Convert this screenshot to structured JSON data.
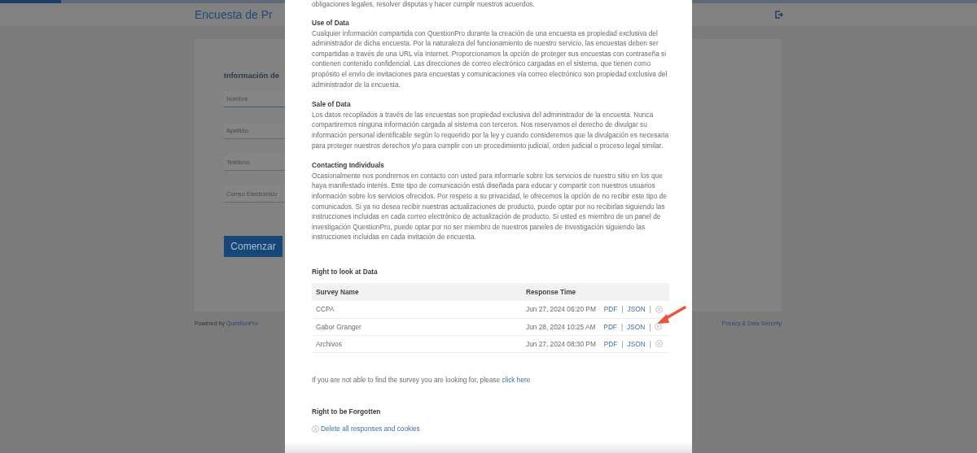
{
  "page": {
    "progress": {
      "level": 0.0625
    },
    "title": "Encuesta de Pr",
    "form_heading": "Información de",
    "fields": [
      {
        "placeholder": "Nombre",
        "focused": true
      },
      {
        "placeholder": "Apellido",
        "focused": false
      },
      {
        "placeholder": "Teléfono",
        "focused": false
      },
      {
        "placeholder": "Correo Electrónico",
        "focused": false
      }
    ],
    "start_button": "Comenzar",
    "footer_prefix": "Powered by",
    "footer_brand": "QuestionPro",
    "footer_right": "Privacy & Data Security"
  },
  "modal": {
    "intro_tail": "obligaciones legales, resolver disputas y hacer cumplir nuestros acuerdos.",
    "sections": [
      {
        "heading": "Use of Data",
        "text": "Cualquier información compartida con QuestionPro durante la creación de una encuesta es propiedad exclusiva del administrador de dicha encuesta. Por la naturaleza del funcionamiento de nuestro servicio, las encuestas deben ser compartidas a través de una URL vía Internet. Proporcionamos la opción de proteger sus encuestas con contraseña si contienen contenido confidencial. Las direcciones de correo electrónico cargadas en el sistema, que tienen como propósito el envío de invitaciones para encuestas y comunicaciones vía correo electrónico son propiedad exclusiva del administrador de la encuesta."
      },
      {
        "heading": "Sale of Data",
        "text": "Los datos recopilados a través de las encuestas son propiedad exclusiva del administrador de la encuesta. Nunca compartiremos ninguna información cargada al sistema con terceros. Nos reservamos el derecho de divulgar su información personal identificable según lo requerido por la ley y cuando consideremos que la divulgación es necesaria para proteger nuestros derechos y/o para cumplir con un procedimiento judicial, orden judicial o proceso legal similar."
      },
      {
        "heading": "Contacting Individuals",
        "text": "Ocasionalmente nos pondremos en contacto con usted para informarle sobre los servicios de nuestro sitio en los que haya manifestado interés. Este tipo de comunicación está diseñada para educar y compartir con nuestros usuarios información sobre los servicios ofrecidos. Por respeto a su privacidad, le ofrecemos la opción de no recibir este tipo de comunicados. Si ya no desea recibir nuestras actualizaciones de producto, puede optar por no recibirlas siguiendo las instrucciones incluidas en cada correo electrónico de actualización de producto. Si usted es miembro de un panel de investigación QuestionPro, puede optar por no ser miembro de nuestros paneles de investigación siguiendo las instrucciones incluidas en cada invitación de encuesta."
      }
    ],
    "data_heading": "Right to look at Data",
    "table": {
      "columns": [
        "Survey Name",
        "Response Time"
      ],
      "separator": "|",
      "rows": [
        {
          "survey": "CCPA",
          "time": "Jun 27, 2024 06:20 PM",
          "links": [
            "PDF",
            "JSON"
          ]
        },
        {
          "survey": "Gabor Granger",
          "time": "Jun 28, 2024 10:25 AM",
          "links": [
            "PDF",
            "JSON"
          ]
        },
        {
          "survey": "Archivos",
          "time": "Jun 27, 2024 08:30 PM",
          "links": [
            "PDF",
            "JSON"
          ]
        }
      ]
    },
    "note": "If you are not able to find the survey you are looking for, please",
    "note_link": "click here",
    "forget_heading": "Right to be Forgotten",
    "forget_link": "Delete all responses and cookies"
  }
}
